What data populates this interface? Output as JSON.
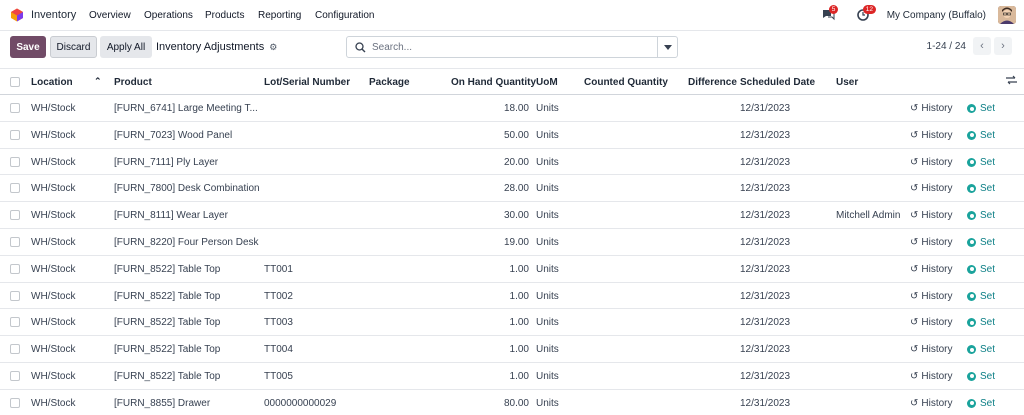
{
  "app": {
    "name": "Inventory"
  },
  "menu": [
    "Overview",
    "Operations",
    "Products",
    "Reporting",
    "Configuration"
  ],
  "systray": {
    "messages_count": "5",
    "activities_count": "12",
    "company": "My Company (Buffalo)"
  },
  "control": {
    "save_label": "Save",
    "discard_label": "Discard",
    "apply_all_label": "Apply All",
    "title": "Inventory Adjustments",
    "search_placeholder": "Search...",
    "pager": "1-24 / 24"
  },
  "columns": {
    "location": "Location",
    "product": "Product",
    "lot": "Lot/Serial Number",
    "package": "Package",
    "on_hand": "On Hand Quantity",
    "uom": "UoM",
    "counted": "Counted Quantity",
    "difference": "Difference",
    "scheduled": "Scheduled Date",
    "user": "User"
  },
  "row_actions": {
    "history": "History",
    "set": "Set"
  },
  "rows": [
    {
      "location": "WH/Stock",
      "product": "[FURN_6741] Large Meeting T...",
      "lot": "",
      "qty": "18.00",
      "uom": "Units",
      "date": "12/31/2023",
      "user": ""
    },
    {
      "location": "WH/Stock",
      "product": "[FURN_7023] Wood Panel",
      "lot": "",
      "qty": "50.00",
      "uom": "Units",
      "date": "12/31/2023",
      "user": ""
    },
    {
      "location": "WH/Stock",
      "product": "[FURN_7111] Ply Layer",
      "lot": "",
      "qty": "20.00",
      "uom": "Units",
      "date": "12/31/2023",
      "user": ""
    },
    {
      "location": "WH/Stock",
      "product": "[FURN_7800] Desk Combination",
      "lot": "",
      "qty": "28.00",
      "uom": "Units",
      "date": "12/31/2023",
      "user": ""
    },
    {
      "location": "WH/Stock",
      "product": "[FURN_8111] Wear Layer",
      "lot": "",
      "qty": "30.00",
      "uom": "Units",
      "date": "12/31/2023",
      "user": "Mitchell Admin"
    },
    {
      "location": "WH/Stock",
      "product": "[FURN_8220] Four Person Desk",
      "lot": "",
      "qty": "19.00",
      "uom": "Units",
      "date": "12/31/2023",
      "user": ""
    },
    {
      "location": "WH/Stock",
      "product": "[FURN_8522] Table Top",
      "lot": "TT001",
      "qty": "1.00",
      "uom": "Units",
      "date": "12/31/2023",
      "user": ""
    },
    {
      "location": "WH/Stock",
      "product": "[FURN_8522] Table Top",
      "lot": "TT002",
      "qty": "1.00",
      "uom": "Units",
      "date": "12/31/2023",
      "user": ""
    },
    {
      "location": "WH/Stock",
      "product": "[FURN_8522] Table Top",
      "lot": "TT003",
      "qty": "1.00",
      "uom": "Units",
      "date": "12/31/2023",
      "user": ""
    },
    {
      "location": "WH/Stock",
      "product": "[FURN_8522] Table Top",
      "lot": "TT004",
      "qty": "1.00",
      "uom": "Units",
      "date": "12/31/2023",
      "user": ""
    },
    {
      "location": "WH/Stock",
      "product": "[FURN_8522] Table Top",
      "lot": "TT005",
      "qty": "1.00",
      "uom": "Units",
      "date": "12/31/2023",
      "user": ""
    },
    {
      "location": "WH/Stock",
      "product": "[FURN_8855] Drawer",
      "lot": "0000000000029",
      "qty": "80.00",
      "uom": "Units",
      "date": "12/31/2023",
      "user": ""
    }
  ]
}
